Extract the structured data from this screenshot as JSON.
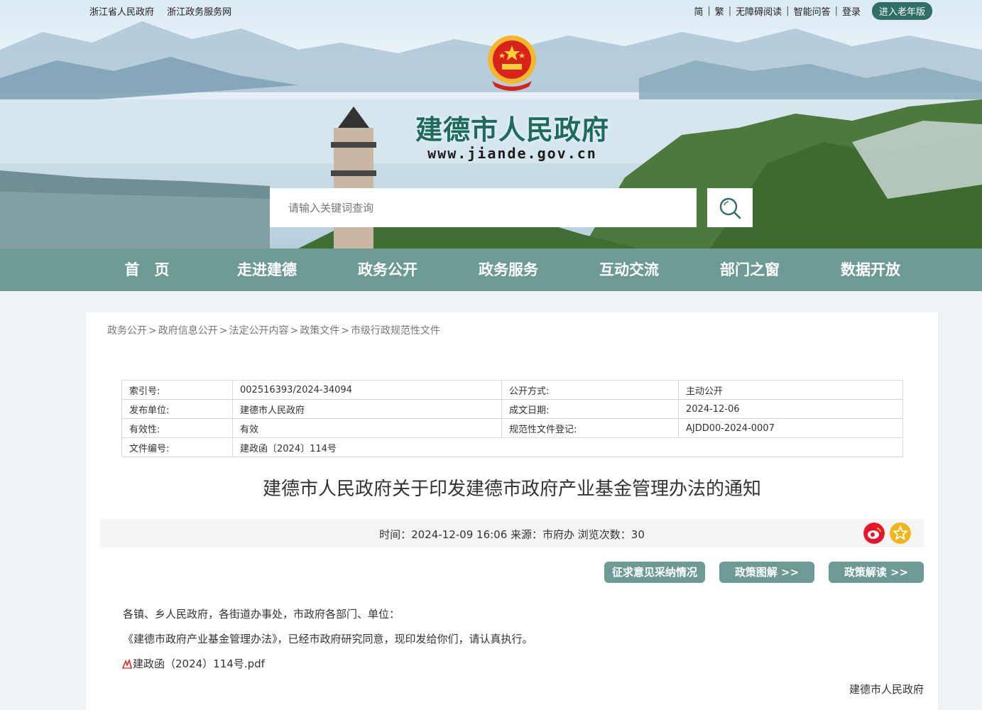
{
  "topbar": {
    "left_links": [
      "浙江省人民政府",
      "浙江政务服务网"
    ],
    "right_links": [
      "简",
      "繁",
      "无障碍阅读",
      "智能问答",
      "登录"
    ],
    "elder_mode": "进入老年版"
  },
  "header": {
    "site_title": "建德市人民政府",
    "site_url": "www.jiande.gov.cn"
  },
  "search": {
    "placeholder": "请输入关键词查询"
  },
  "nav": {
    "items": [
      "首　页",
      "走进建德",
      "政务公开",
      "政务服务",
      "互动交流",
      "部门之窗",
      "数据开放"
    ]
  },
  "breadcrumb": [
    "政务公开",
    "政府信息公开",
    "法定公开内容",
    "政策文件",
    "市级行政规范性文件"
  ],
  "meta": {
    "index_label": "索引号:",
    "index_value": "002516393/2024-34094",
    "open_method_label": "公开方式:",
    "open_method_value": "主动公开",
    "issuer_label": "发布单位:",
    "issuer_value": "建德市人民政府",
    "date_label": "成文日期:",
    "date_value": "2024-12-06",
    "validity_label": "有效性:",
    "validity_value": "有效",
    "reg_label": "规范性文件登记:",
    "reg_value": "AJDD00-2024-0007",
    "doc_no_label": "文件编号:",
    "doc_no_value": "建政函〔2024〕114号"
  },
  "article": {
    "title": "建德市人民政府关于印发建德市政府产业基金管理办法的通知",
    "info": "时间：2024-12-09 16:06 来源：市府办 浏览次数：30",
    "buttons": [
      "征求意见采纳情况",
      "政策图解 >>",
      "政策解读 >>"
    ],
    "salutation": "各镇、乡人民政府，各街道办事处，市政府各部门、单位：",
    "body": "《建德市政府产业基金管理办法》，已经市政府研究同意，现印发给你们，请认真执行。",
    "attachment": "建政函（2024）114号.pdf",
    "signature": "建德市人民政府"
  },
  "colors": {
    "nav_bg": "#6d9a93",
    "title_green": "#1d6b5d",
    "weibo_red": "#e6162d",
    "fav_yellow": "#f5b31a"
  }
}
